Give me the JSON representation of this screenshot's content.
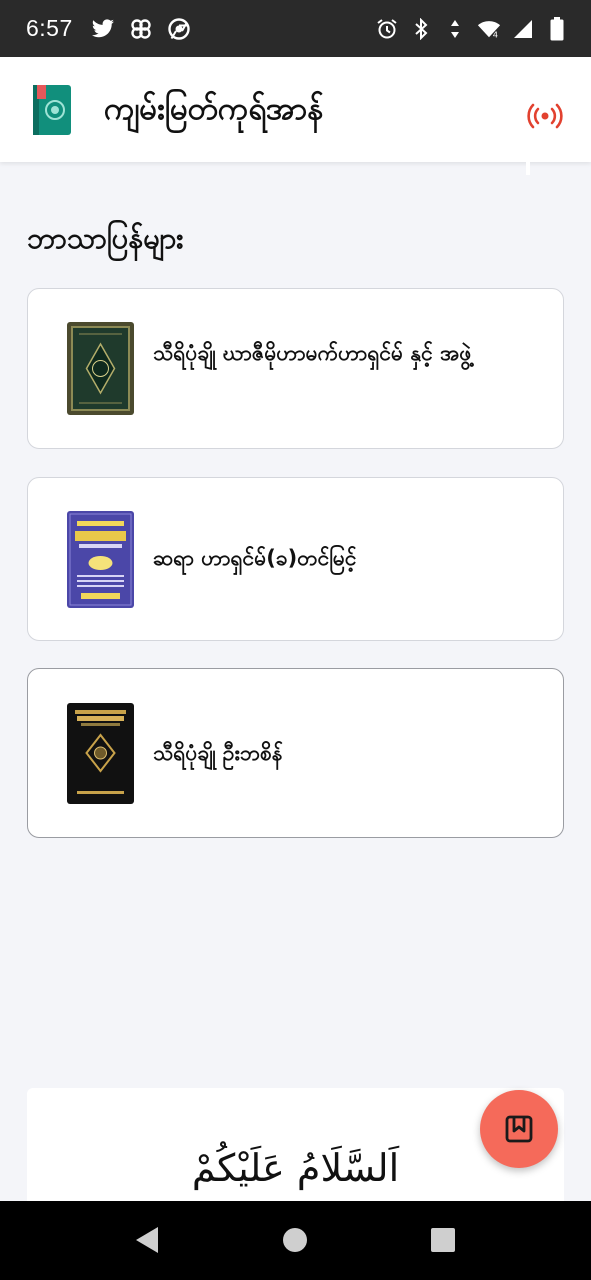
{
  "status_bar": {
    "time": "6:57",
    "left_icons": [
      "twitter-icon",
      "pinwheel-icon",
      "chrome-icon"
    ],
    "right_icons": [
      "alarm-icon",
      "bluetooth-icon",
      "data-arrows-icon",
      "wifi-icon",
      "signal-icon",
      "battery-icon"
    ]
  },
  "app_bar": {
    "title": "ကျမ်းမြတ်ကုရ်အာန်",
    "logo_icon": "quran-book-logo",
    "live_icon": "broadcast-icon",
    "accent_color": "#e2412f"
  },
  "section": {
    "title": "ဘာသာပြန်များ"
  },
  "books": [
    {
      "title": "သီရိပုံချို ဃာဇီမိုဟာမက်ဟာရှင်မ် နှင့် အဖွဲ့",
      "cover": "dark-green-ornate-cover"
    },
    {
      "title": "ဆရာ ဟာရှင်မ်(ခ)တင်မြင့်",
      "cover": "purple-blue-cover"
    },
    {
      "title": "သီရိပုံချို ဦးဘစိန်",
      "cover": "black-gold-cover"
    }
  ],
  "greeting": {
    "text": "اَلسَّلَامُ عَلَيْكُمْ"
  },
  "fab": {
    "icon": "bookmark-book-icon",
    "color": "#f56a5a"
  },
  "nav_bar": {
    "buttons": [
      "back-icon",
      "home-icon",
      "recents-icon"
    ]
  }
}
